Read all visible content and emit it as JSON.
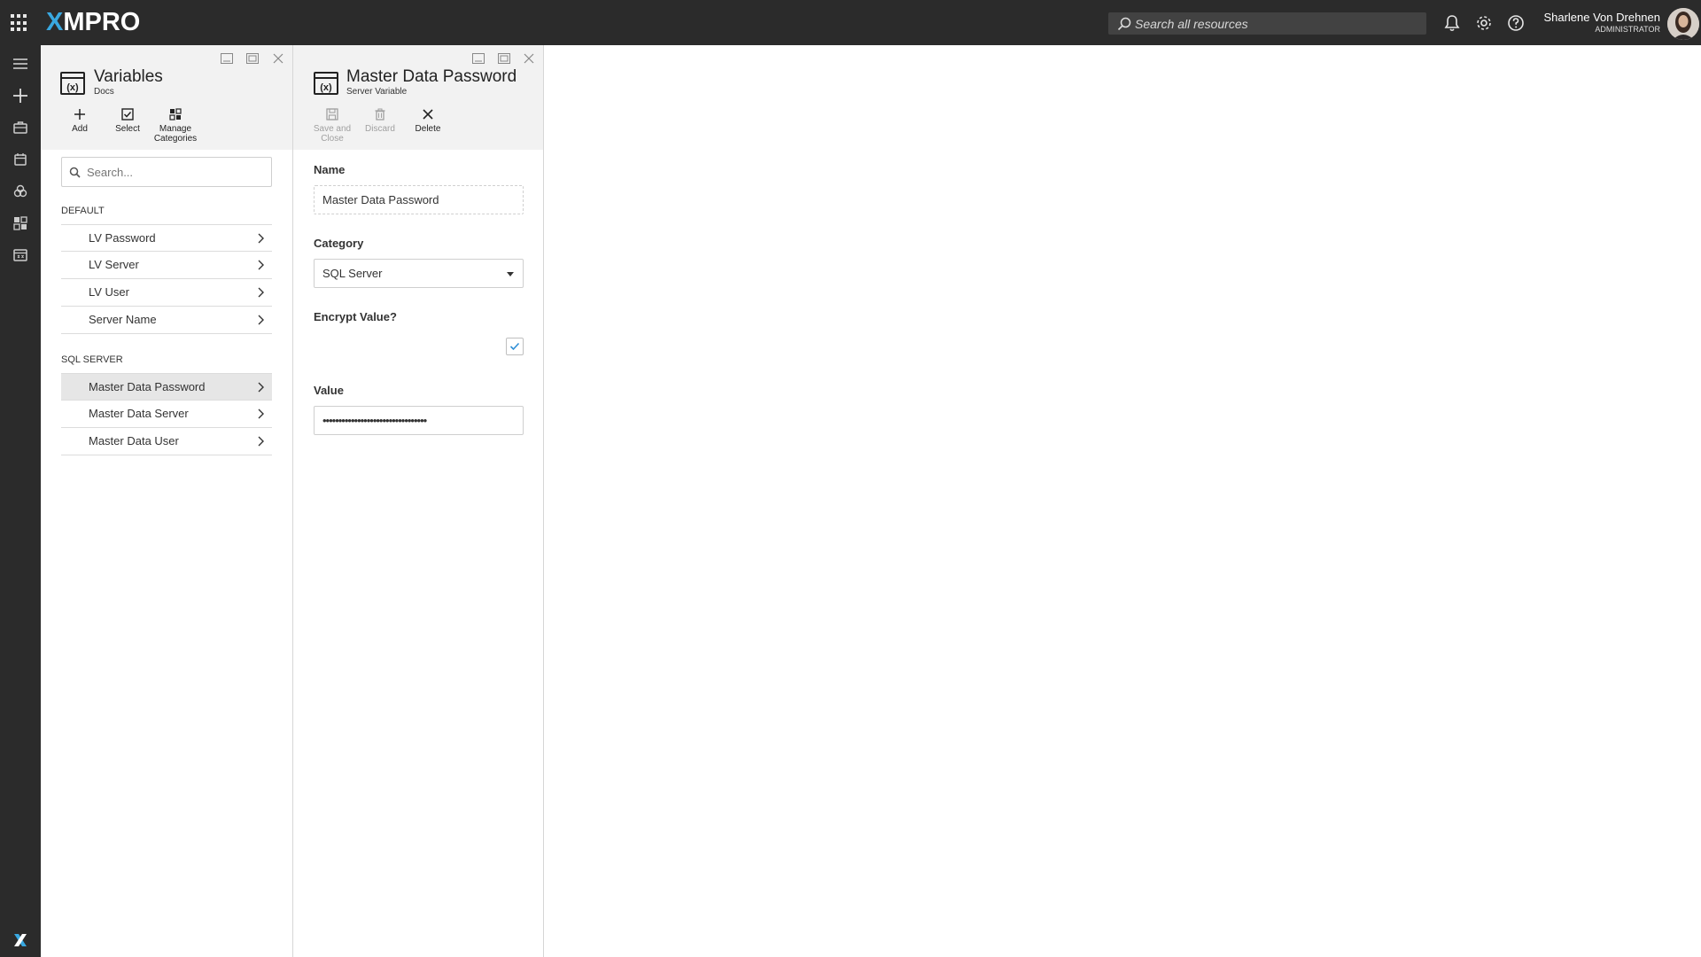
{
  "app": {
    "logo_prefix": "X",
    "logo_rest": "MPRO",
    "search_placeholder": "Search all resources",
    "user_name": "Sharlene Von Drehnen",
    "user_role": "ADMINISTRATOR"
  },
  "variables_panel": {
    "title": "Variables",
    "subtitle": "Docs",
    "toolbar": {
      "add_label": "Add",
      "select_label": "Select",
      "manage_line1": "Manage",
      "manage_line2": "Categories"
    },
    "search_placeholder": "Search...",
    "groups": [
      {
        "name": "DEFAULT",
        "items": [
          "LV Password",
          "LV Server",
          "LV User",
          "Server Name"
        ]
      },
      {
        "name": "SQL SERVER",
        "items": [
          "Master Data Password",
          "Master Data Server",
          "Master Data User"
        ]
      }
    ],
    "selected_item": "Master Data Password"
  },
  "detail_panel": {
    "title": "Master Data Password",
    "subtitle": "Server Variable",
    "toolbar": {
      "save_line1": "Save and",
      "save_line2": "Close",
      "discard_label": "Discard",
      "delete_label": "Delete"
    },
    "fields": {
      "name_label": "Name",
      "name_value": "Master Data Password",
      "category_label": "Category",
      "category_value": "SQL Server",
      "encrypt_label": "Encrypt Value?",
      "encrypt_checked": true,
      "value_label": "Value",
      "value_masked": "•••••••••••••••••••••••••••••••••"
    }
  }
}
